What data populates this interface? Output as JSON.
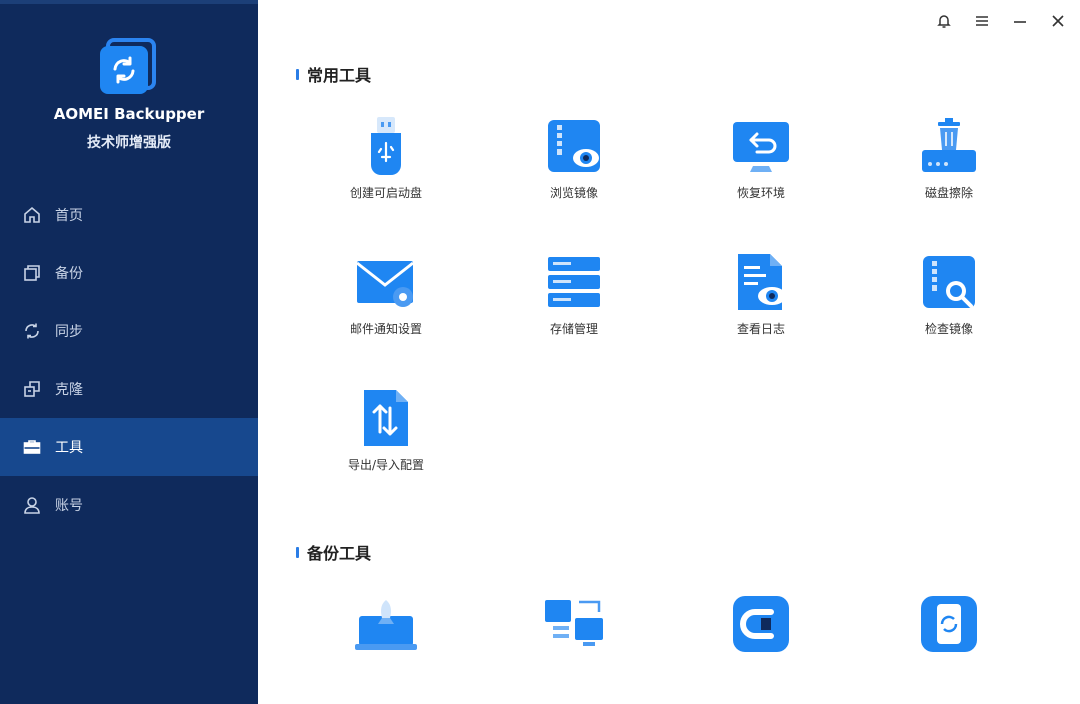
{
  "app": {
    "name": "AOMEI Backupper",
    "edition": "技术师增强版"
  },
  "nav": [
    {
      "label": "首页",
      "icon": "home-icon",
      "active": false
    },
    {
      "label": "备份",
      "icon": "backup-icon",
      "active": false
    },
    {
      "label": "同步",
      "icon": "sync-icon",
      "active": false
    },
    {
      "label": "克隆",
      "icon": "clone-icon",
      "active": false
    },
    {
      "label": "工具",
      "icon": "toolbox-icon",
      "active": true
    },
    {
      "label": "账号",
      "icon": "user-icon",
      "active": false
    }
  ],
  "window_controls": [
    "bell-icon",
    "menu-icon",
    "minimize-icon",
    "close-icon"
  ],
  "sections": {
    "common": {
      "title": "常用工具",
      "tools": [
        {
          "label": "创建可启动盘",
          "icon": "usb-drive-icon"
        },
        {
          "label": "浏览镜像",
          "icon": "explore-image-icon"
        },
        {
          "label": "恢复环境",
          "icon": "recovery-env-icon"
        },
        {
          "label": "磁盘擦除",
          "icon": "disk-wipe-icon"
        },
        {
          "label": "邮件通知设置",
          "icon": "email-settings-icon"
        },
        {
          "label": "存储管理",
          "icon": "storage-icon"
        },
        {
          "label": "查看日志",
          "icon": "view-logs-icon"
        },
        {
          "label": "检查镜像",
          "icon": "check-image-icon"
        },
        {
          "label": "导出/导入配置",
          "icon": "export-import-icon"
        }
      ]
    },
    "backup": {
      "title": "备份工具",
      "tools": [
        {
          "icon": "pxe-boot-icon"
        },
        {
          "icon": "image-deploy-icon"
        },
        {
          "icon": "enterprise-data-icon"
        },
        {
          "icon": "phone-backup-icon"
        }
      ]
    }
  },
  "colors": {
    "sidebar": "#0f2a5c",
    "active": "#17488e",
    "accent": "#1f86f2"
  }
}
